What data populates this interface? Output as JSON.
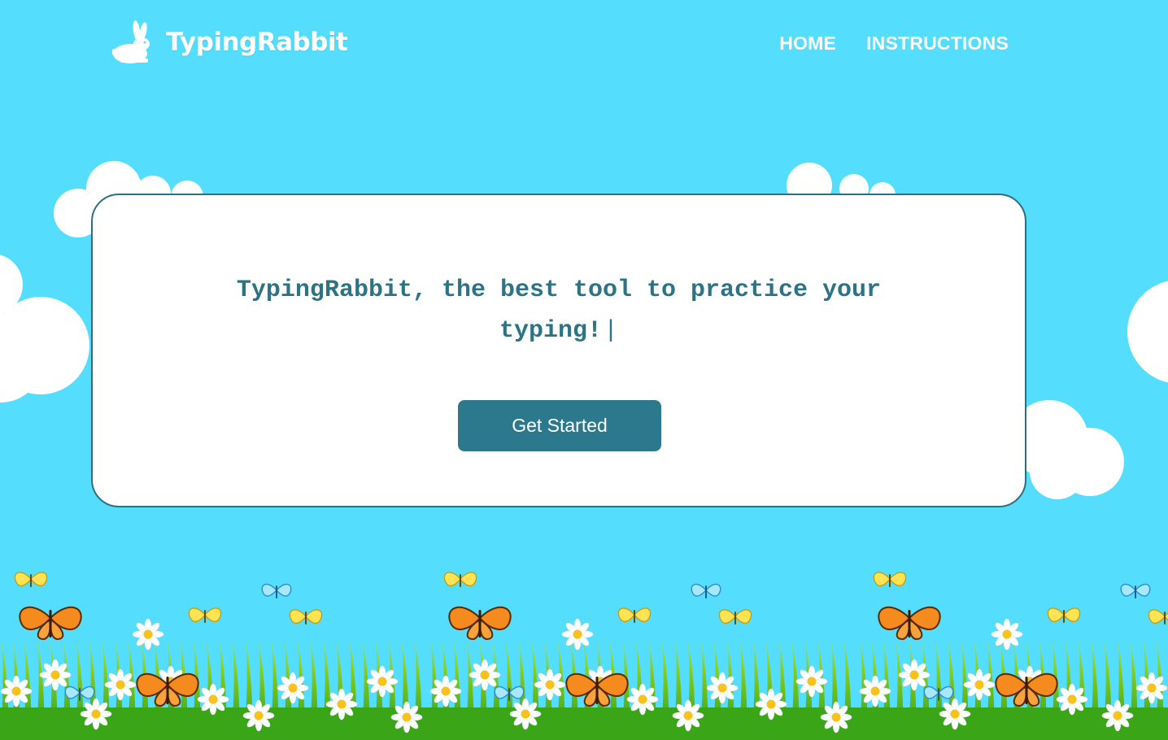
{
  "header": {
    "logo_text": "TypingRabbit",
    "nav": [
      {
        "label": "HOME"
      },
      {
        "label": "INSTRUCTIONS"
      }
    ]
  },
  "hero": {
    "headline": "TypingRabbit, the best tool to practice your typing!",
    "cursor": "|",
    "cta_label": "Get Started"
  },
  "colors": {
    "sky": "#55ddfd",
    "card_border": "#2b6f80",
    "headline": "#2c7386",
    "button": "#2c788d"
  },
  "icons": [
    "rabbit-icon",
    "cloud",
    "butterfly",
    "daisy",
    "grass"
  ]
}
